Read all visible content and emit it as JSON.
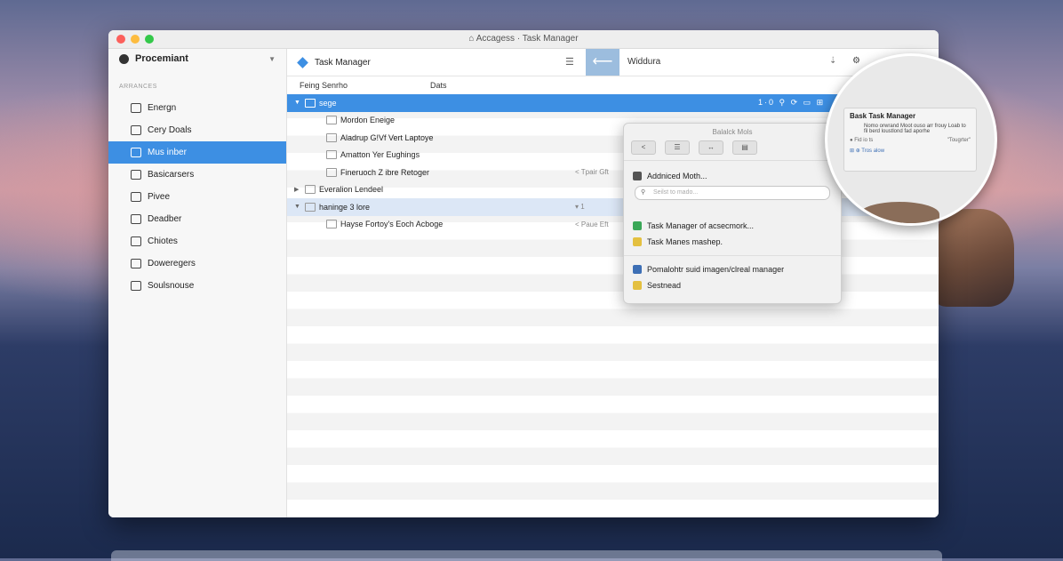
{
  "window": {
    "title": "⌂ Accagess · Task Manager"
  },
  "sidebar": {
    "header": "Procemiant",
    "section": "ARRANCES",
    "items": [
      {
        "label": "Energn",
        "icon": "grid-icon",
        "active": false
      },
      {
        "label": "Cery Doals",
        "icon": "doc-icon",
        "active": false
      },
      {
        "label": "Mus inber",
        "icon": "image-icon",
        "active": true
      },
      {
        "label": "Basicarsers",
        "icon": "list-icon",
        "active": false
      },
      {
        "label": "Pivee",
        "icon": "pin-icon",
        "active": false
      },
      {
        "label": "Deadber",
        "icon": "photo-icon",
        "active": false
      },
      {
        "label": "Chiotes",
        "icon": "page-icon",
        "active": false
      },
      {
        "label": "Doweregers",
        "icon": "folder-icon",
        "active": false
      },
      {
        "label": "Soulsnouse",
        "icon": "check-icon",
        "active": false
      }
    ]
  },
  "toolbar": {
    "title": "Task Manager",
    "search": "Widdura"
  },
  "columns": {
    "c1": "Feing Senrho",
    "c2": "Dats"
  },
  "rows": [
    {
      "label": "sege",
      "indent": 0,
      "selected": true,
      "disclosure": "▼"
    },
    {
      "label": "Mordon Eneige",
      "indent": 2
    },
    {
      "label": "Aladrup G!Vf Vert Laptoye",
      "indent": 2
    },
    {
      "label": "Amatton Yer Eughings",
      "indent": 2
    },
    {
      "label": "Fineruoch Z ibre Retoger",
      "indent": 2,
      "meta": "< Tpair Gft"
    },
    {
      "label": "Everalion Lendeel",
      "indent": 0,
      "disclosure": "▶"
    },
    {
      "label": "haninge 3 lore",
      "indent": 0,
      "highlight": true,
      "disclosure": "▼",
      "meta": "▾ 1"
    },
    {
      "label": "Hayse Fortoy's Eoch Acboge",
      "indent": 2,
      "meta": "< Paue Eft"
    }
  ],
  "selection_tools": "1·0 ⚲ ⟳ ▭ ⊞",
  "popover": {
    "title": "Balalck Mols",
    "tools": [
      "<",
      "☰",
      "↔",
      "▤"
    ],
    "items": [
      {
        "label": "Addniced Moth...",
        "icon": "grid-icon",
        "color": "#555555"
      }
    ],
    "search_placeholder": "Seilst to mado...",
    "items2": [
      {
        "label": "Task Manager of acsecmork...",
        "icon": "check-icon",
        "color": "#3aa757"
      },
      {
        "label": "Task Manes mashep.",
        "icon": "note-icon",
        "color": "#e4c040"
      }
    ],
    "items3": [
      {
        "label": "Pomalohtr suid imagen/clreal manager",
        "icon": "globe-icon",
        "color": "#3d6fb5"
      },
      {
        "label": "Sestnead",
        "icon": "star-icon",
        "color": "#e4c040"
      }
    ]
  },
  "magnifier": {
    "title": "Bask Task Manager",
    "subtitle": "Nomo orwrand Moot ouso arr frouy Loab to fil berd loustlond fad aporhe",
    "left_action": "● Fid io ts",
    "right_action": "\"Tougrter\"",
    "footer": "⊞ ⊕ Tros alow"
  }
}
